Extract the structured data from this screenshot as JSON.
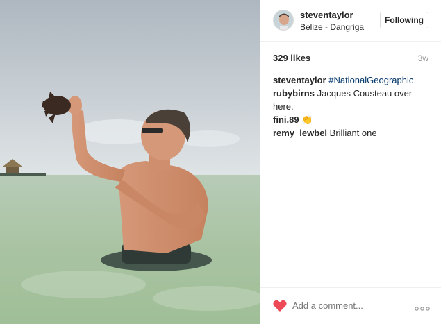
{
  "post": {
    "username": "steventaylor",
    "location": "Belize - Dangriga",
    "follow_label": "Following",
    "likes": "329 likes",
    "time_ago": "3w",
    "comments": [
      {
        "user": "steventaylor",
        "text": "#NationalGeographic",
        "is_tag": true
      },
      {
        "user": "rubybirns",
        "text": "Jacques Cousteau over here.",
        "is_tag": false
      },
      {
        "user": "fini.89",
        "text": "👏",
        "is_tag": false
      },
      {
        "user": "remy_lewbel",
        "text": "Brilliant one",
        "is_tag": false
      }
    ],
    "comment_placeholder": "Add a comment...",
    "like_color": "#ed4956",
    "icons": [
      "heart-icon",
      "more-options-icon"
    ]
  }
}
